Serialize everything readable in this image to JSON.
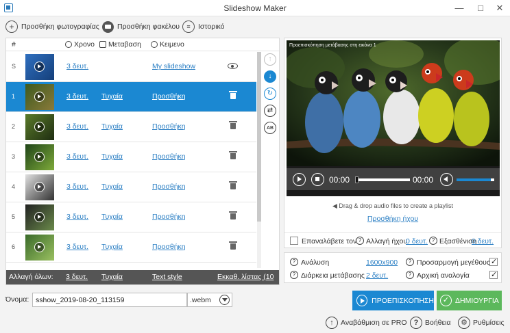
{
  "window": {
    "title": "Slideshow Maker",
    "minimize_icon": "minimize-icon",
    "restore_icon": "restore-icon",
    "close_icon": "close-icon"
  },
  "toolbar": {
    "add_photos_label": "Προσθήκη φωτογραφίας",
    "add_folder_label": "Προσθήκη φακέλου",
    "history_label": "Ιστορικό"
  },
  "list": {
    "headers": {
      "number": "#",
      "duration": "Χρονο",
      "transition": "Μεταβαση",
      "text": "Κειμενο"
    },
    "rows": [
      {
        "num": "S",
        "duration": "3 δευτ.",
        "transition": "",
        "text": "My slideshow",
        "action_icon": "eye-icon",
        "selected": false
      },
      {
        "num": "1",
        "duration": "3 δευτ.",
        "transition": "Τυχαία",
        "text": "Προσθήκη",
        "action_icon": "trash-icon",
        "selected": true
      },
      {
        "num": "2",
        "duration": "3 δευτ.",
        "transition": "Τυχαία",
        "text": "Προσθήκη",
        "action_icon": "trash-icon",
        "selected": false
      },
      {
        "num": "3",
        "duration": "3 δευτ.",
        "transition": "Τυχαία",
        "text": "Προσθήκη",
        "action_icon": "trash-icon",
        "selected": false
      },
      {
        "num": "4",
        "duration": "3 δευτ.",
        "transition": "Τυχαία",
        "text": "Προσθήκη",
        "action_icon": "trash-icon",
        "selected": false
      },
      {
        "num": "5",
        "duration": "3 δευτ.",
        "transition": "Τυχαία",
        "text": "Προσθήκη",
        "action_icon": "trash-icon",
        "selected": false
      },
      {
        "num": "6",
        "duration": "3 δευτ.",
        "transition": "Τυχαία",
        "text": "Προσθήκη",
        "action_icon": "trash-icon",
        "selected": false
      }
    ],
    "footer": {
      "change_all": "Αλλαγή όλων:",
      "duration": "3 δευτ.",
      "transition": "Τυχαία",
      "text_style": "Text style",
      "clear_list": "Εκκαθ. λίστας (10"
    },
    "side_tools": [
      "move-up-icon",
      "move-down-icon",
      "rotate-icon",
      "shuffle-icon",
      "ab-sort-icon"
    ]
  },
  "preview": {
    "caption": "Προεπισκόπηση μετάβασης στη εικόνα 1",
    "current_time": "00:00",
    "total_time": "00:00",
    "progress": 0,
    "volume": 0.9,
    "dropzone_text": "Drag & drop audio files to create a playlist",
    "add_audio_link": "Προσθήκη ήχου",
    "repeat_label": "Επαναλάβετε τον",
    "repeat_checked": false,
    "change_audio_label": "Αλλαγή ήχου",
    "change_audio_value": "0 δευτ.",
    "fade_label": "Εξασθένιση",
    "fade_value": "0 δευτ."
  },
  "settings": {
    "resolution_label": "Ανάλυση",
    "resolution_value": "1600x900",
    "transition_duration_label": "Διάρκεια μετάβασης",
    "transition_duration_value": "2 δευτ.",
    "resize_label": "Προσαρμογή μεγέθους",
    "resize_checked": true,
    "aspect_label": "Αρχική αναλογία",
    "aspect_checked": true
  },
  "output": {
    "name_label": "Όνομα:",
    "filename": "sshow_2019-08-20_113159",
    "extension": ".webm"
  },
  "actions": {
    "preview_button": "ΠΡΟΕΠΙΣΚΟΠΗΣΗ",
    "create_button": "ΔΗΜΙΟΥΡΓΙΑ",
    "upgrade_label": "Αναβάθμιση σε PRO",
    "help_label": "Βοήθεια",
    "settings_label": "Ρυθμίσεις"
  },
  "colors": {
    "accent": "#1b88d2",
    "create": "#5cb85c",
    "link": "#2b7fc4"
  }
}
